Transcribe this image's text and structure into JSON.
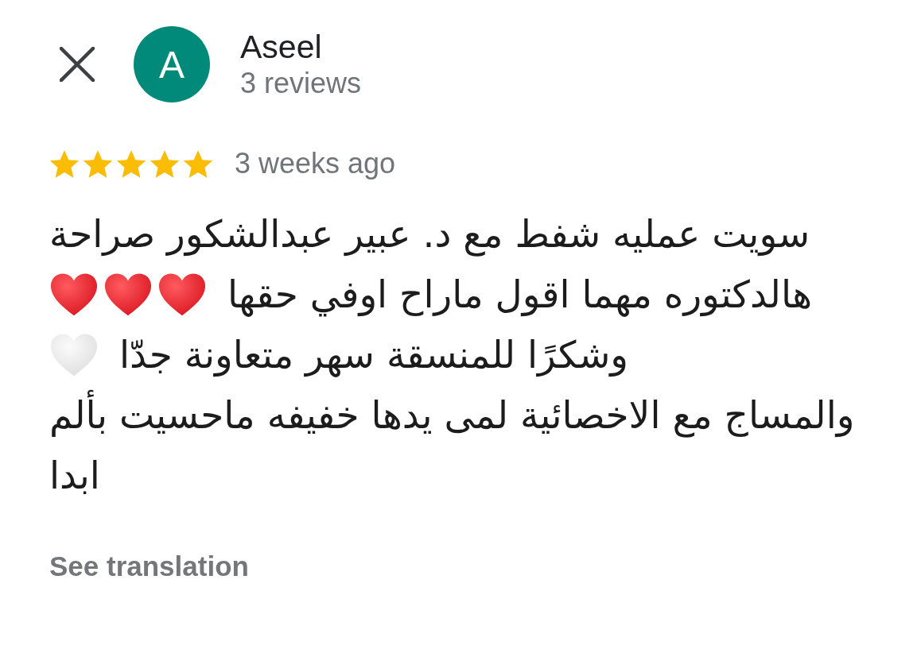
{
  "reviewer": {
    "initial": "A",
    "name": "Aseel",
    "review_count": "3 reviews"
  },
  "rating": {
    "stars": 5,
    "time": "3 weeks ago"
  },
  "review": {
    "lines": [
      {
        "text": "سويت عمليه شفط مع د. عبير عبدالشكور صراحة"
      },
      {
        "text": "هالدكتوره مهما اقول ماراح اوفي حقها",
        "emojis": [
          {
            "kind": "red_heart"
          },
          {
            "kind": "red_heart"
          },
          {
            "kind": "red_heart"
          }
        ]
      },
      {
        "text": "وشكرًا للمنسقة سهر متعاونة جدّا",
        "emojis": [
          {
            "kind": "white_heart"
          }
        ]
      },
      {
        "text": "والمساج مع الاخصائية لمى يدها خفيفه ماحسيت بألم ابدا"
      }
    ]
  },
  "see_translation": "See translation"
}
